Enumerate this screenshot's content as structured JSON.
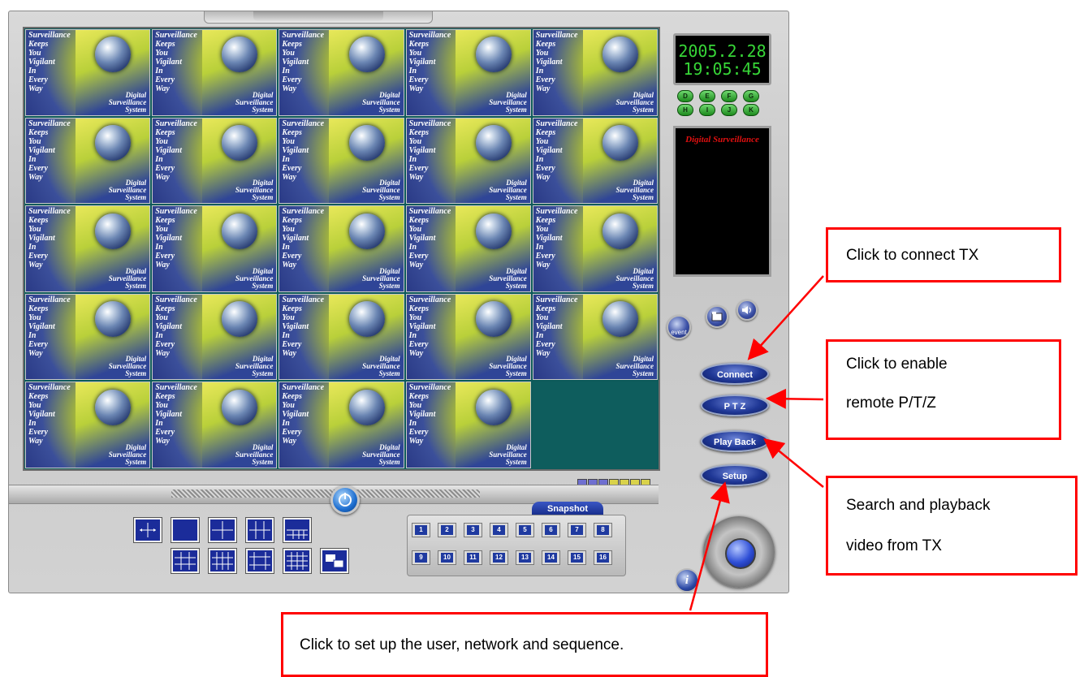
{
  "clock": {
    "date": "2005.2.28",
    "time": "19:05:45"
  },
  "channels": [
    "D",
    "E",
    "F",
    "G",
    "H",
    "I",
    "J",
    "K"
  ],
  "screen_title": "Digital Surveillance",
  "tile": {
    "slogan": "Surveillance\nKeeps\nYou\nVigilant\nIn\nEvery\nWay",
    "brand": "Digital\nSurveillance\nSystem"
  },
  "grid": {
    "rows": 5,
    "cols": 5,
    "filled_cells": 24
  },
  "event_label": "event",
  "buttons": {
    "connect": "Connect",
    "ptz": "P T Z",
    "playback": "Play Back",
    "setup": "Setup"
  },
  "snapshot": {
    "label": "Snapshot",
    "numbers": [
      "1",
      "2",
      "3",
      "4",
      "5",
      "6",
      "7",
      "8",
      "9",
      "10",
      "11",
      "12",
      "13",
      "14",
      "15",
      "16"
    ]
  },
  "info_label": "i",
  "callouts": {
    "connect": "Click to connect TX",
    "ptz_line1": "Click to enable",
    "ptz_line2": "remote P/T/Z",
    "playback_line1": "Search and playback",
    "playback_line2": "video from TX",
    "setup": "Click to set up the user, network and sequence."
  },
  "colors": {
    "callout_border": "#ff0000",
    "clock_digits": "#37d637",
    "screen_title": "#e01010"
  }
}
